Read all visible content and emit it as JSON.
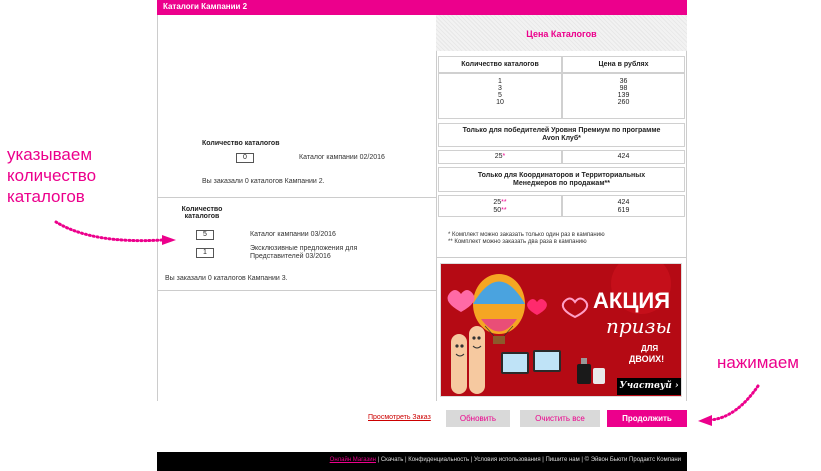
{
  "header": {
    "title": "Каталоги Кампании 2"
  },
  "campaign2": {
    "qty_label": "Количество каталогов",
    "qty_value": "0",
    "item_label": "Каталог кампании 02/2016",
    "summary": "Вы заказали 0 каталогов Кампании 2."
  },
  "campaign3": {
    "qty_label_line1": "Количество",
    "qty_label_line2": "каталогов",
    "item1_value": "5",
    "item1_label": "Каталог кампании 03/2016",
    "item2_value": "1",
    "item2_label_line1": "Эксклюзивные предложения для",
    "item2_label_line2": "Представителей 03/2016",
    "summary": "Вы заказали 0 каталогов Кампании 3."
  },
  "price_table": {
    "title": "Цена Каталогов",
    "col_qty": "Количество каталогов",
    "col_price": "Цена в рублях",
    "rows": [
      {
        "qty": "1",
        "price": "36"
      },
      {
        "qty": "3",
        "price": "98"
      },
      {
        "qty": "5",
        "price": "139"
      },
      {
        "qty": "10",
        "price": "260"
      }
    ],
    "premium_heading_line1": "Только для победителей Уровня Премиум по программе",
    "premium_heading_line2": "Avon Клуб*",
    "premium_qty": "25",
    "premium_qty_mark": "*",
    "premium_price": "424",
    "coord_heading_line1": "Только для Координаторов и Территориальных",
    "coord_heading_line2": "Менеджеров по продажам**",
    "coord_qty1": "25",
    "coord_qty1_mark": "**",
    "coord_qty2": "50",
    "coord_qty2_mark": "**",
    "coord_price1": "424",
    "coord_price2": "619",
    "footnote1": "* Комплект можно заказать только один раз в кампанию",
    "footnote2": "** Комплект можно заказать два раза в кампанию"
  },
  "promo": {
    "line1": "АКЦИЯ",
    "line2": "призы",
    "line3": "ДЛЯ",
    "line4": "ДВОИХ!",
    "cta": "Участвуй",
    "colors": {
      "background": "#b50a14",
      "cta_bg": "#000000"
    }
  },
  "annotations": {
    "left_line1": "указываем",
    "left_line2": "количество",
    "left_line3": "каталогов",
    "right": "нажимаем"
  },
  "actions": {
    "view_order": "Просмотреть Заказ",
    "refresh": "Обновить",
    "clear_all": "Очистить все",
    "continue": "Продолжить"
  },
  "footer": {
    "online_store": "Онлайн Магазин",
    "rest": " | Скачать | Конфиденциальность | Условия использования | Пишите нам | © Эйвон Бьюти Продактс Компани"
  },
  "colors": {
    "accent": "#ec008c",
    "button_grey": "#d9d9d9",
    "footer": "#000000"
  }
}
